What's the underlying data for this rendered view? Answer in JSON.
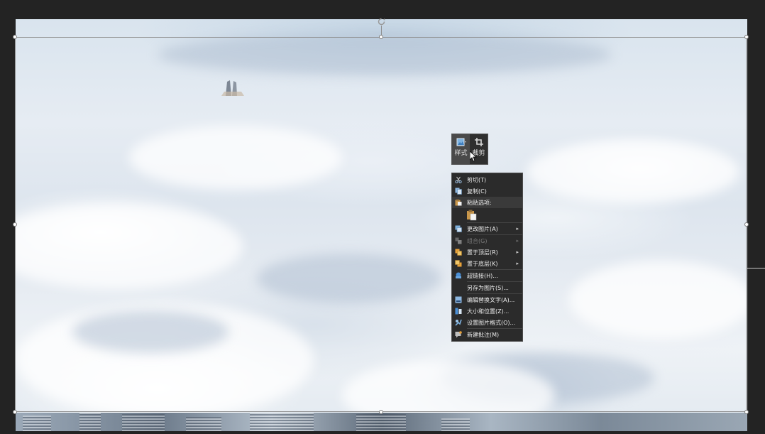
{
  "mini_toolbar": {
    "style_label": "样式",
    "crop_label": "裁剪"
  },
  "context_menu": {
    "items": [
      {
        "label": "剪切(T)",
        "icon": "scissors-icon",
        "enabled": true
      },
      {
        "label": "复制(C)",
        "icon": "copy-icon",
        "enabled": true
      },
      {
        "label": "粘贴选项:",
        "icon": "paste-icon",
        "enabled": true
      },
      {
        "label": "更改图片(A)",
        "icon": "change-picture-icon",
        "enabled": true,
        "submenu": true
      },
      {
        "label": "组合(G)",
        "icon": "group-icon",
        "enabled": false,
        "submenu": true
      },
      {
        "label": "置于顶层(R)",
        "icon": "bring-to-front-icon",
        "enabled": true,
        "submenu": true
      },
      {
        "label": "置于底层(K)",
        "icon": "send-to-back-icon",
        "enabled": true,
        "submenu": true
      },
      {
        "label": "超链接(H)...",
        "icon": "hyperlink-icon",
        "enabled": true
      },
      {
        "label": "另存为图片(S)...",
        "icon": "",
        "enabled": true
      },
      {
        "label": "编辑替换文字(A)...",
        "icon": "alt-text-icon",
        "enabled": true
      },
      {
        "label": "大小和位置(Z)...",
        "icon": "size-position-icon",
        "enabled": true
      },
      {
        "label": "设置图片格式(O)...",
        "icon": "format-picture-icon",
        "enabled": true
      },
      {
        "label": "新建批注(M)",
        "icon": "new-comment-icon",
        "enabled": true
      }
    ],
    "submenu_arrow": "▸"
  },
  "colors": {
    "menu_bg": "#2b2b2b",
    "menu_text": "#ededed",
    "disabled_text": "#7a7a7a",
    "canvas_bg": "#232323"
  }
}
